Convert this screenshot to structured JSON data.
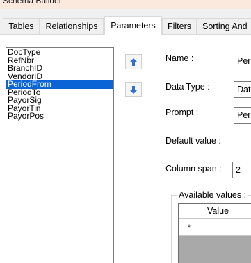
{
  "window": {
    "title": "Schema Builder"
  },
  "tabs": [
    {
      "label": "Tables"
    },
    {
      "label": "Relationships"
    },
    {
      "label": "Parameters"
    },
    {
      "label": "Filters"
    },
    {
      "label": "Sorting And"
    }
  ],
  "active_tab": "Parameters",
  "parameters": {
    "items": [
      "DocType",
      "RefNbr",
      "BranchID",
      "VendorID",
      "PeriodFrom",
      "PeriodTo",
      "PayorSig",
      "PayorTin",
      "PayorPos"
    ],
    "selected": "PeriodFrom"
  },
  "move_buttons": {
    "up_icon": "arrow-up-icon",
    "down_icon": "arrow-down-icon"
  },
  "form": {
    "name_label": "Name :",
    "name_value": "Peri",
    "datatype_label": "Data Type :",
    "datatype_value": "Dat",
    "prompt_label": "Prompt :",
    "prompt_value": "Peri",
    "default_label": "Default value :",
    "default_value": "",
    "colspan_label": "Column span :",
    "colspan_value": "2"
  },
  "available_values": {
    "title": "Available values :",
    "column_header": "Value",
    "new_row_marker": "*"
  },
  "colors": {
    "selection": "#0a64d6",
    "titlebar": "#fbe9dd",
    "icon_blue": "#2f6fd6"
  }
}
